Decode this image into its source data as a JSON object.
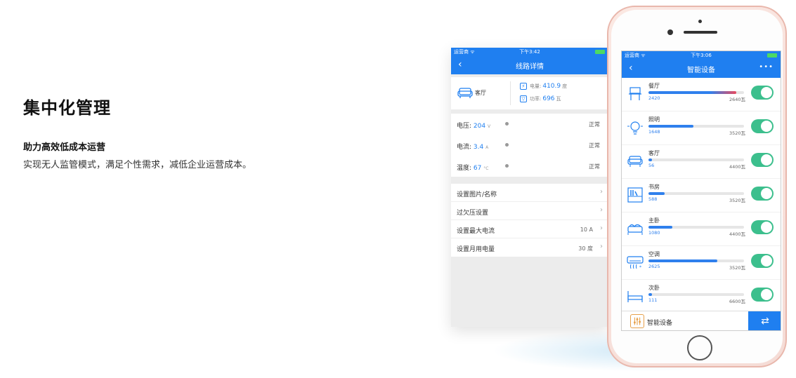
{
  "intro": {
    "title": "集中化管理",
    "subtitle": "助力高效低成本运营",
    "description": "实现无人监管模式，满足个性需求，减低企业运营成本。"
  },
  "back_screen": {
    "status_bar": {
      "carrier": "运营商 ᯤ",
      "time": "下午3:42"
    },
    "nav": {
      "back_icon": "‹",
      "title": "线路详情"
    },
    "room": {
      "name": "客厅"
    },
    "metrics": [
      {
        "icon": "⚡",
        "label": "电量:",
        "value": "410.9",
        "unit": "度"
      },
      {
        "icon": "▽",
        "label": "功率:",
        "value": "696",
        "unit": "瓦"
      }
    ],
    "status_rows": [
      {
        "label": "电压:",
        "value": "204",
        "unit": "V",
        "state": "正常"
      },
      {
        "label": "电流:",
        "value": "3.4",
        "unit": "A",
        "state": "正常"
      },
      {
        "label": "温度:",
        "value": "67",
        "unit": "°C",
        "state": "正常"
      }
    ],
    "settings": [
      {
        "label": "设置图片/名称",
        "value": "",
        "chevron": "›"
      },
      {
        "label": "过欠压设置",
        "value": "",
        "chevron": "›"
      },
      {
        "label": "设置最大电流",
        "value": "10 A",
        "chevron": "›"
      },
      {
        "label": "设置月用电量",
        "value": "30 度",
        "chevron": "›"
      }
    ]
  },
  "front_screen": {
    "status_bar": {
      "carrier": "运营商 ᯤ",
      "time": "下午3:06"
    },
    "nav": {
      "back_icon": "‹",
      "title": "智能设备",
      "more_icon": "•••"
    },
    "devices": [
      {
        "name": "餐厅",
        "icon": "dining-icon",
        "value": "2420",
        "max": "2640瓦",
        "level": 0.92,
        "alert": true,
        "on": true
      },
      {
        "name": "照明",
        "icon": "bulb-icon",
        "value": "1648",
        "max": "3520瓦",
        "level": 0.47,
        "alert": false,
        "on": true
      },
      {
        "name": "客厅",
        "icon": "sofa-icon",
        "value": "56",
        "max": "4400瓦",
        "level": 0.04,
        "alert": false,
        "on": true
      },
      {
        "name": "书房",
        "icon": "bookshelf-icon",
        "value": "588",
        "max": "3520瓦",
        "level": 0.17,
        "alert": false,
        "on": true
      },
      {
        "name": "主卧",
        "icon": "bed-icon",
        "value": "1080",
        "max": "4400瓦",
        "level": 0.25,
        "alert": false,
        "on": true
      },
      {
        "name": "空调",
        "icon": "air-conditioner-icon",
        "value": "2625",
        "max": "3520瓦",
        "level": 0.72,
        "alert": false,
        "on": true
      },
      {
        "name": "次卧",
        "icon": "single-bed-icon",
        "value": "111",
        "max": "6600瓦",
        "level": 0.04,
        "alert": false,
        "on": true
      }
    ],
    "tabbar": {
      "label": "智能设备",
      "swap_icon": "⇄"
    }
  },
  "colors": {
    "primary": "#1f7ff0",
    "toggle_on": "#3cbf8d",
    "alert": "#e84a5f",
    "phone_body": "#f5dcd6"
  }
}
